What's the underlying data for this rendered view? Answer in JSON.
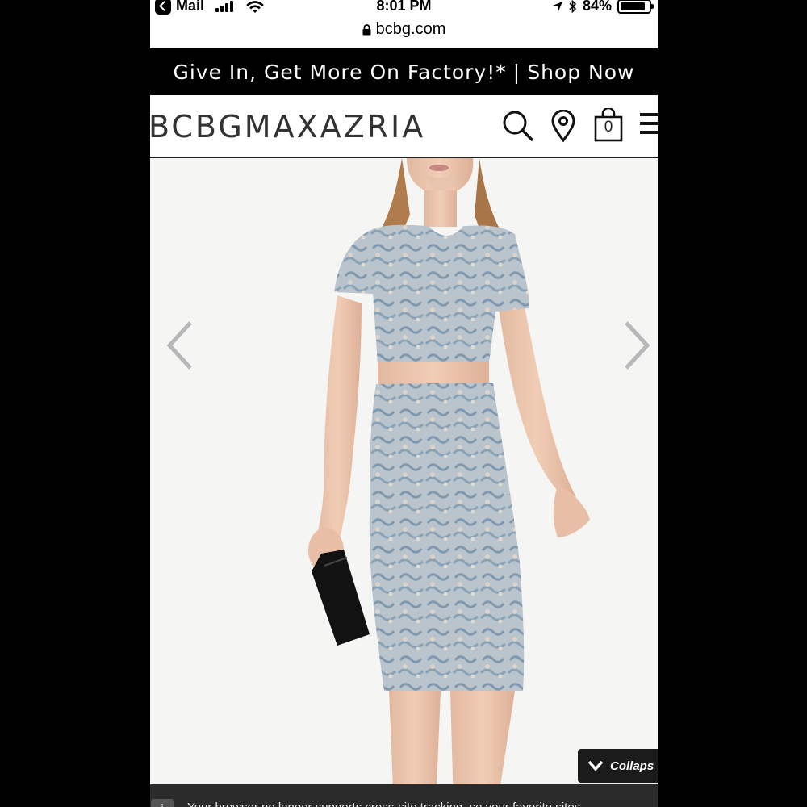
{
  "status_bar": {
    "back_app": "Mail",
    "time": "8:01 PM",
    "battery": "84%",
    "battery_level": 0.84
  },
  "browser": {
    "url": "bcbg.com"
  },
  "promo": {
    "text": "Give In, Get More On Factory!*",
    "separator": "|",
    "link": "Shop Now"
  },
  "header": {
    "brand": "BCBGMAXAZRIA",
    "bag_count": "0",
    "icons": [
      "search-icon",
      "location-pin-icon",
      "shopping-bag-icon",
      "hamburger-menu-icon"
    ]
  },
  "product_gallery": {
    "prev_icon": "chevron-left-icon",
    "next_icon": "chevron-right-icon"
  },
  "collapse": {
    "label": "Collaps"
  },
  "cookie_banner": {
    "icon": "info-icon",
    "text": "Your browser no longer supports cross-site tracking, so your favorite sites"
  },
  "colors": {
    "frame": "#000000",
    "promo_bg": "#000000",
    "page_bg": "#ffffff",
    "photo_bg": "#f5f5f4",
    "dress": "#9fb3c3",
    "dark_overlay": "#1b1b1b"
  }
}
